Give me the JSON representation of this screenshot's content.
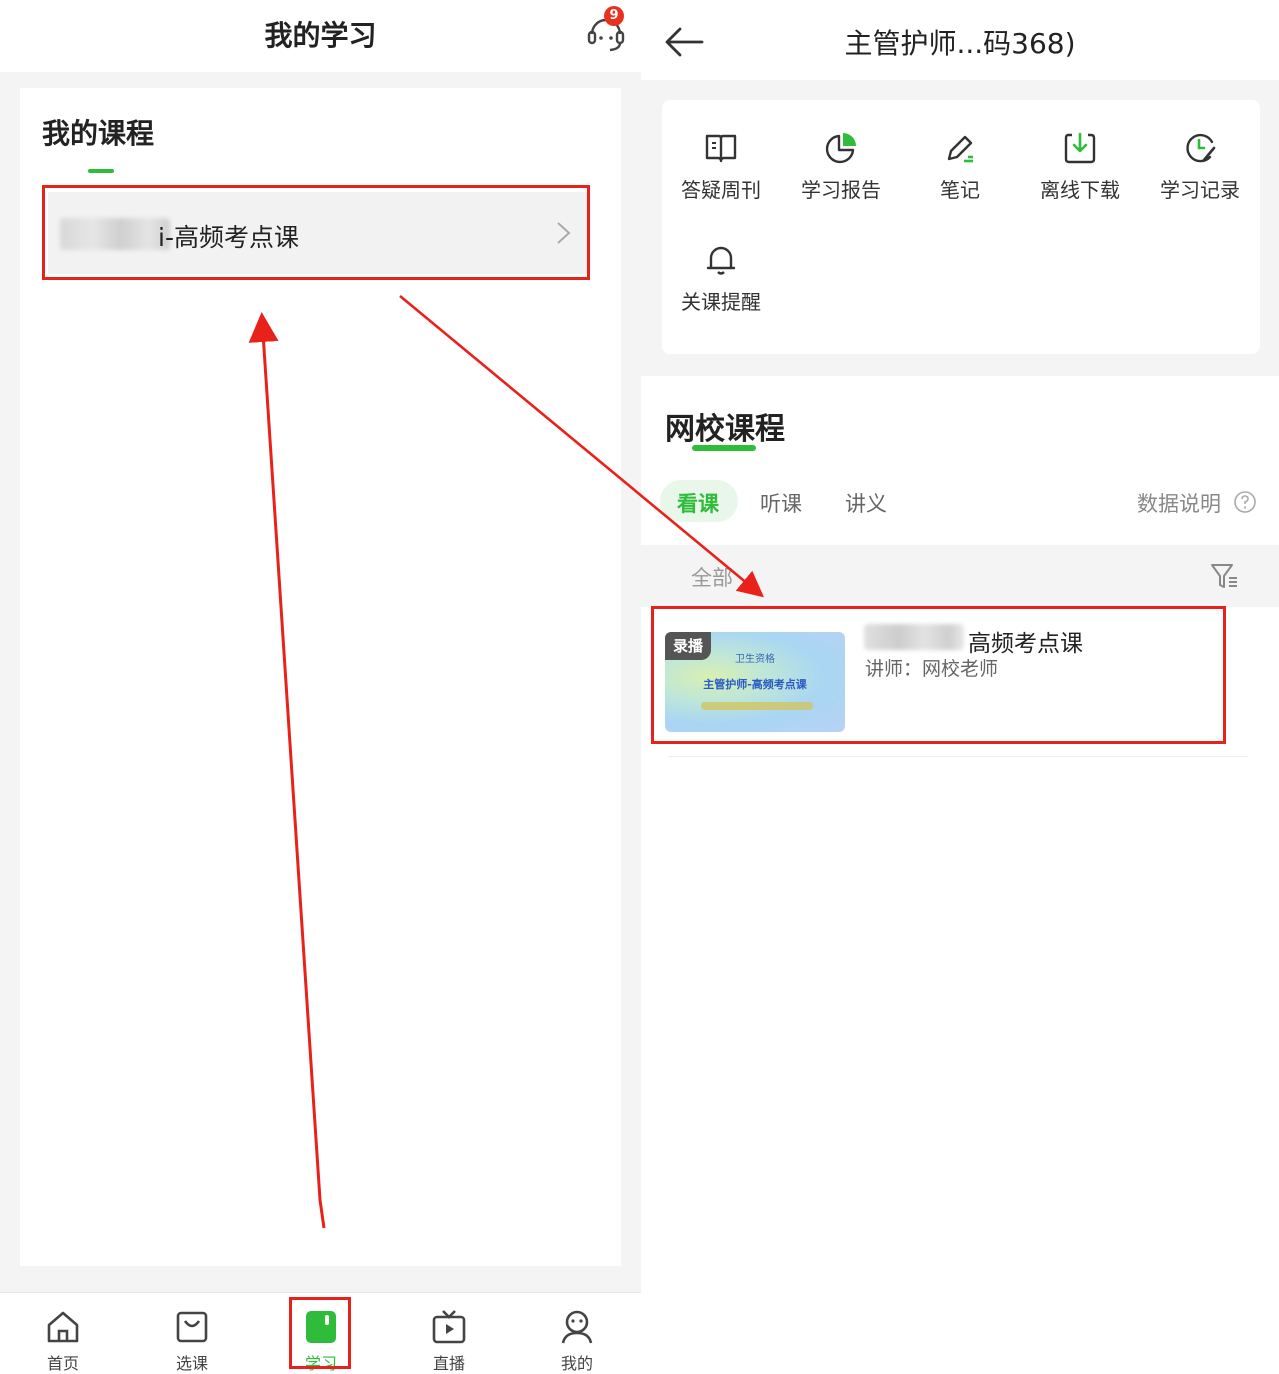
{
  "left": {
    "header": {
      "title": "我的学习",
      "support_badge": "9",
      "support_icon": "headset-icon"
    },
    "courses_title": "我的课程",
    "course_item": {
      "label": "i-高频考点课",
      "chevron_icon": "chevron-right-icon"
    },
    "tabbar": [
      {
        "label": "首页",
        "icon": "home-icon"
      },
      {
        "label": "选课",
        "icon": "shopping-bag-icon"
      },
      {
        "label": "学习",
        "icon": "book-icon",
        "active": true
      },
      {
        "label": "直播",
        "icon": "tv-icon"
      },
      {
        "label": "我的",
        "icon": "profile-icon"
      }
    ]
  },
  "right": {
    "header": {
      "title": "主管护师...码368)",
      "back_icon": "back-arrow-icon"
    },
    "tools": [
      {
        "label": "答疑周刊",
        "icon": "book-open-icon"
      },
      {
        "label": "学习报告",
        "icon": "pie-chart-icon"
      },
      {
        "label": "笔记",
        "icon": "pen-icon"
      },
      {
        "label": "离线下载",
        "icon": "download-icon"
      },
      {
        "label": "学习记录",
        "icon": "history-icon"
      },
      {
        "label": "关课提醒",
        "icon": "bell-icon"
      }
    ],
    "section_title": "网校课程",
    "sub_tabs": {
      "watch": "看课",
      "listen": "听课",
      "notes": "讲义"
    },
    "data_note": "数据说明",
    "filter_label": "全部",
    "record": {
      "badge": "录播",
      "thumb_top": "卫生资格",
      "thumb_main": "主管护师-高频考点课",
      "title": "高频考点课",
      "teacher": "讲师：网校老师"
    }
  },
  "colors": {
    "accent": "#2fbc3a",
    "annotation": "#e8221a",
    "badge": "#e8321f"
  }
}
